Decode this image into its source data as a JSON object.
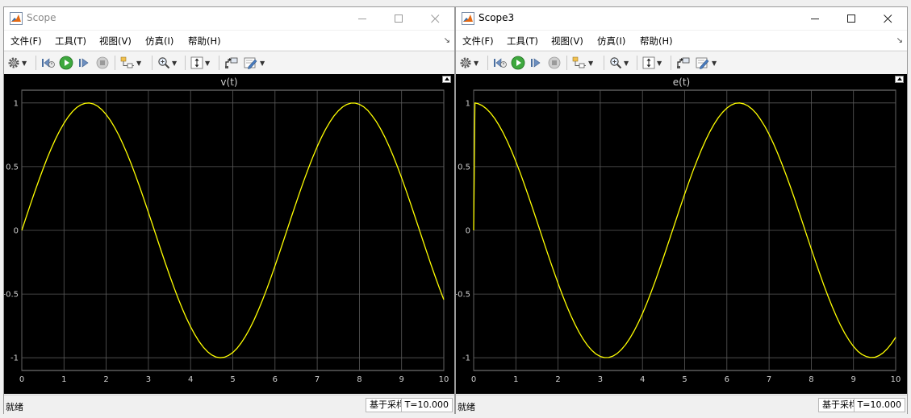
{
  "windows": [
    {
      "title": "Scope",
      "menu": [
        "文件(F)",
        "工具(T)",
        "视图(V)",
        "仿真(I)",
        "帮助(H)"
      ],
      "menu_overflow": "↘",
      "plot_title": "v(t)",
      "status": {
        "text": "就绪",
        "mode": "基于采样",
        "time": "T=10.000"
      }
    },
    {
      "title": "Scope3",
      "menu": [
        "文件(F)",
        "工具(T)",
        "视图(V)",
        "仿真(I)",
        "帮助(H)"
      ],
      "menu_overflow": "↘",
      "plot_title": "e(t)",
      "status": {
        "text": "就绪",
        "mode": "基于采样",
        "time": "T=10.000"
      }
    }
  ],
  "toolbar_icons": [
    "gear-icon",
    "step-back-icon",
    "run-icon",
    "step-forward-icon",
    "stop-icon",
    "signal-select-icon",
    "zoom-icon",
    "autoscale-icon",
    "highlight-block-icon",
    "edit-icon"
  ],
  "colors": {
    "trace": "#ffff00",
    "plot_bg": "#000000",
    "grid": "#5a5a5a",
    "axis_text": "#cfcfcf"
  },
  "chart_data": [
    {
      "type": "line",
      "title": "v(t)",
      "xlabel": "",
      "ylabel": "",
      "xlim": [
        0,
        10
      ],
      "ylim": [
        -1.1,
        1.1
      ],
      "xticks": [
        0,
        1,
        2,
        3,
        4,
        5,
        6,
        7,
        8,
        9,
        10
      ],
      "yticks": [
        -1,
        -0.5,
        0,
        0.5,
        1
      ],
      "grid": true,
      "series": [
        {
          "color": "#ffff00",
          "x": [
            0,
            0.1,
            0.2,
            0.3,
            0.4,
            0.5,
            0.6,
            0.7,
            0.8,
            0.9,
            1.0,
            1.1,
            1.2,
            1.3,
            1.4,
            1.5,
            1.6,
            1.7,
            1.8,
            1.9,
            2.0,
            2.1,
            2.2,
            2.3,
            2.4,
            2.5,
            2.6,
            2.7,
            2.8,
            2.9,
            3.0,
            3.1,
            3.2,
            3.3,
            3.4,
            3.5,
            3.6,
            3.7,
            3.8,
            3.9,
            4.0,
            4.1,
            4.2,
            4.3,
            4.4,
            4.5,
            4.6,
            4.7,
            4.8,
            4.9,
            5.0,
            5.1,
            5.2,
            5.3,
            5.4,
            5.5,
            5.6,
            5.7,
            5.8,
            5.9,
            6.0,
            6.1,
            6.2,
            6.3,
            6.4,
            6.5,
            6.6,
            6.7,
            6.8,
            6.9,
            7.0,
            7.1,
            7.2,
            7.3,
            7.4,
            7.5,
            7.6,
            7.7,
            7.8,
            7.9,
            8.0,
            8.1,
            8.2,
            8.3,
            8.4,
            8.5,
            8.6,
            8.7,
            8.8,
            8.9,
            9.0,
            9.1,
            9.2,
            9.3,
            9.4,
            9.5,
            9.6,
            9.7,
            9.8,
            9.9,
            10.0
          ],
          "y": [
            0.0,
            0.1,
            0.199,
            0.296,
            0.389,
            0.479,
            0.565,
            0.644,
            0.717,
            0.783,
            0.841,
            0.891,
            0.932,
            0.964,
            0.985,
            0.997,
            1.0,
            0.992,
            0.974,
            0.946,
            0.909,
            0.863,
            0.808,
            0.746,
            0.675,
            0.598,
            0.516,
            0.427,
            0.335,
            0.239,
            0.141,
            0.042,
            -0.058,
            -0.158,
            -0.256,
            -0.351,
            -0.443,
            -0.53,
            -0.612,
            -0.688,
            -0.757,
            -0.818,
            -0.872,
            -0.916,
            -0.952,
            -0.978,
            -0.994,
            -1.0,
            -0.996,
            -0.982,
            -0.959,
            -0.926,
            -0.883,
            -0.832,
            -0.773,
            -0.706,
            -0.631,
            -0.551,
            -0.465,
            -0.374,
            -0.279,
            -0.182,
            -0.083,
            0.017,
            0.117,
            0.215,
            0.312,
            0.405,
            0.494,
            0.578,
            0.657,
            0.729,
            0.794,
            0.85,
            0.899,
            0.938,
            0.968,
            0.988,
            0.999,
            0.999,
            0.989,
            0.97,
            0.941,
            0.9,
            0.854,
            0.798,
            0.734,
            0.663,
            0.585,
            0.501,
            0.412,
            0.319,
            0.223,
            0.124,
            0.025,
            -0.075,
            -0.174,
            -0.272,
            -0.366,
            -0.457,
            -0.544
          ]
        }
      ]
    },
    {
      "type": "line",
      "title": "e(t)",
      "xlabel": "",
      "ylabel": "",
      "xlim": [
        0,
        10
      ],
      "ylim": [
        -1.1,
        1.1
      ],
      "xticks": [
        0,
        1,
        2,
        3,
        4,
        5,
        6,
        7,
        8,
        9,
        10
      ],
      "yticks": [
        -1,
        -0.5,
        0,
        0.5,
        1
      ],
      "grid": true,
      "series": [
        {
          "color": "#ffff00",
          "x": [
            0,
            0.03,
            0.1,
            0.2,
            0.3,
            0.4,
            0.5,
            0.6,
            0.7,
            0.8,
            0.9,
            1.0,
            1.1,
            1.2,
            1.3,
            1.4,
            1.5,
            1.6,
            1.7,
            1.8,
            1.9,
            2.0,
            2.1,
            2.2,
            2.3,
            2.4,
            2.5,
            2.6,
            2.7,
            2.8,
            2.9,
            3.0,
            3.1,
            3.2,
            3.3,
            3.4,
            3.5,
            3.6,
            3.7,
            3.8,
            3.9,
            4.0,
            4.1,
            4.2,
            4.3,
            4.4,
            4.5,
            4.6,
            4.7,
            4.8,
            4.9,
            5.0,
            5.1,
            5.2,
            5.3,
            5.4,
            5.5,
            5.6,
            5.7,
            5.8,
            5.9,
            6.0,
            6.1,
            6.2,
            6.3,
            6.4,
            6.5,
            6.6,
            6.7,
            6.8,
            6.9,
            7.0,
            7.1,
            7.2,
            7.3,
            7.4,
            7.5,
            7.6,
            7.7,
            7.8,
            7.9,
            8.0,
            8.1,
            8.2,
            8.3,
            8.4,
            8.5,
            8.6,
            8.7,
            8.8,
            8.9,
            9.0,
            9.1,
            9.2,
            9.3,
            9.4,
            9.5,
            9.6,
            9.7,
            9.8,
            9.9,
            10.0
          ],
          "y": [
            0.0,
            1.0,
            0.995,
            0.98,
            0.955,
            0.921,
            0.878,
            0.825,
            0.765,
            0.697,
            0.622,
            0.54,
            0.454,
            0.362,
            0.267,
            0.17,
            0.071,
            -0.029,
            -0.129,
            -0.227,
            -0.323,
            -0.416,
            -0.505,
            -0.589,
            -0.666,
            -0.737,
            -0.801,
            -0.857,
            -0.904,
            -0.942,
            -0.971,
            -0.99,
            -0.999,
            -0.998,
            -0.987,
            -0.967,
            -0.936,
            -0.897,
            -0.848,
            -0.791,
            -0.726,
            -0.654,
            -0.575,
            -0.49,
            -0.401,
            -0.307,
            -0.211,
            -0.112,
            -0.012,
            0.087,
            0.187,
            0.284,
            0.378,
            0.469,
            0.554,
            0.635,
            0.709,
            0.776,
            0.835,
            0.886,
            0.927,
            0.96,
            0.983,
            0.997,
            1.0,
            0.993,
            0.977,
            0.951,
            0.916,
            0.869,
            0.816,
            0.754,
            0.684,
            0.608,
            0.525,
            0.438,
            0.347,
            0.252,
            0.153,
            0.054,
            -0.046,
            -0.146,
            -0.244,
            -0.339,
            -0.432,
            -0.519,
            -0.602,
            -0.679,
            -0.749,
            -0.811,
            -0.865,
            -0.911,
            -0.948,
            -0.974,
            -0.99,
            -0.998,
            -0.997,
            -0.984,
            -0.962,
            -0.93,
            -0.889,
            -0.839
          ]
        }
      ]
    }
  ]
}
